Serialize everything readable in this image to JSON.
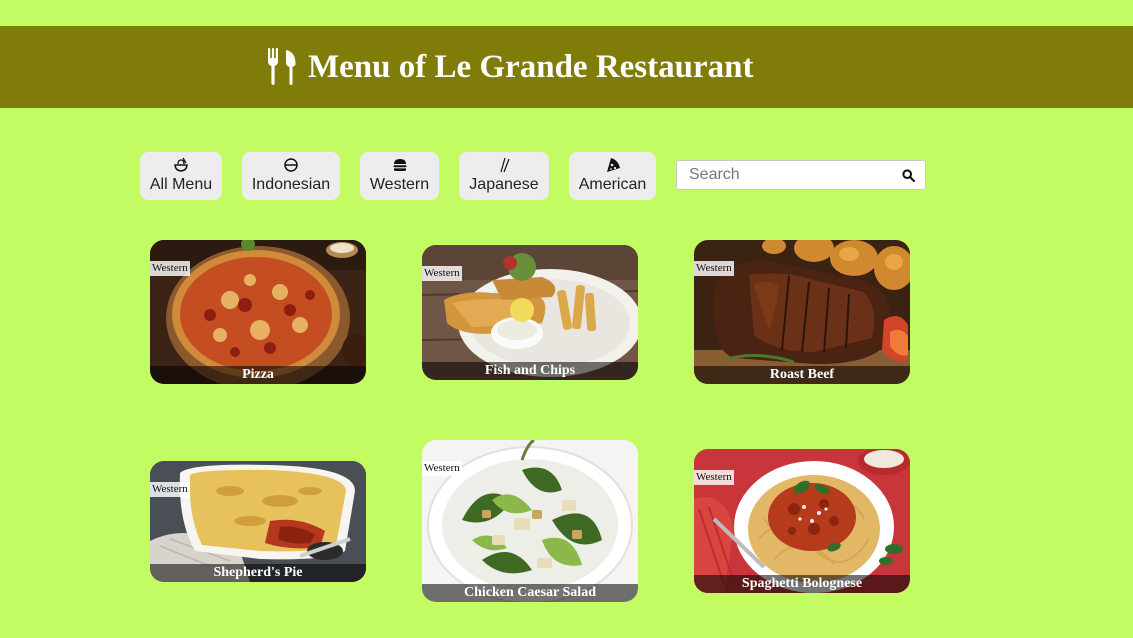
{
  "header": {
    "title": "Menu of Le Grande Restaurant",
    "icon": "fork-knife-icon",
    "background": "#7f7c0a"
  },
  "page": {
    "background": "#c2fc62"
  },
  "filters": [
    {
      "label": "All Menu",
      "icon": "bowl-icon"
    },
    {
      "label": "Indonesian",
      "icon": "rice-bowl-icon"
    },
    {
      "label": "Western",
      "icon": "burger-icon"
    },
    {
      "label": "Japanese",
      "icon": "chopsticks-icon"
    },
    {
      "label": "American",
      "icon": "pizza-icon"
    }
  ],
  "search": {
    "placeholder": "Search",
    "value": "",
    "icon": "search-icon"
  },
  "menu": [
    {
      "name": "Pizza",
      "category": "Western"
    },
    {
      "name": "Fish and Chips",
      "category": "Western"
    },
    {
      "name": "Roast Beef",
      "category": "Western"
    },
    {
      "name": "Shepherd's Pie",
      "category": "Western"
    },
    {
      "name": "Chicken Caesar Salad",
      "category": "Western"
    },
    {
      "name": "Spaghetti Bolognese",
      "category": "Western"
    }
  ]
}
